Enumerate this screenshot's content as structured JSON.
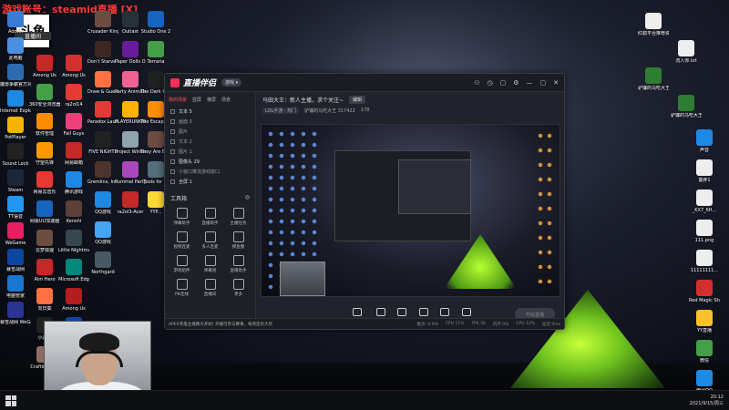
{
  "overlay": {
    "text": "游戏账号：steamid直播 [X]",
    "logo": "斗鱼",
    "logo_sub": "直播间",
    "room": "317422"
  },
  "desktop_left": [
    {
      "label": "Admin",
      "color": "#3a7bd5"
    },
    {
      "label": "此电脑",
      "color": "#4a90e2"
    },
    {
      "label": "魔兽争霸官方对战平台",
      "color": "#2b6cb0"
    },
    {
      "label": "Internet Explorer",
      "color": "#1e88e5"
    },
    {
      "label": "PotPlayer",
      "color": "#f4b400"
    },
    {
      "label": "Sound Lock",
      "color": "#222"
    },
    {
      "label": "Steam",
      "color": "#1b2838"
    },
    {
      "label": "TT语音",
      "color": "#2196f3"
    },
    {
      "label": "WeGame",
      "color": "#e91e63"
    },
    {
      "label": "暴雪战网",
      "color": "#0d47a1"
    },
    {
      "label": "电脑管家",
      "color": "#1976d2"
    },
    {
      "label": "暴雪战网 WeGame版",
      "color": "#283593"
    }
  ],
  "desktop_col2": [
    {
      "label": "Among Us",
      "color": "#c62828"
    },
    {
      "label": "360安全浏览器",
      "color": "#43a047"
    },
    {
      "label": "软件管理",
      "color": "#fb8c00"
    },
    {
      "label": "守望先锋",
      "color": "#ff9800"
    },
    {
      "label": "网易云音乐",
      "color": "#e53935"
    },
    {
      "label": "网易UU加速器",
      "color": "#1565c0"
    },
    {
      "label": "云梦狐狸",
      "color": "#6d4c41"
    },
    {
      "label": "Aim Hero",
      "color": "#c62828"
    },
    {
      "label": "向日葵",
      "color": "#ff7043"
    },
    {
      "label": "小黑盒",
      "color": "#212121"
    },
    {
      "label": "Crafting War",
      "color": "#8d6e63"
    }
  ],
  "desktop_col3": [
    {
      "label": "Among Us",
      "color": "#d32f2f"
    },
    {
      "label": "ra2ol14",
      "color": "#e53935"
    },
    {
      "label": "Fall Guys",
      "color": "#ec407a"
    },
    {
      "label": "网易邮箱",
      "color": "#c62828"
    },
    {
      "label": "腾讯游戏",
      "color": "#1e88e5"
    },
    {
      "label": "Kenshi",
      "color": "#5d4037"
    },
    {
      "label": "Little Nightmares",
      "color": "#37474f"
    },
    {
      "label": "Microsoft Edge",
      "color": "#00897b"
    },
    {
      "label": "Among Us",
      "color": "#b71c1c"
    },
    {
      "label": "英雄联盟",
      "color": "#0d47a1"
    }
  ],
  "desktop_col4": [
    {
      "label": "Crusader Kings III",
      "color": "#6d4c41"
    },
    {
      "label": "Don't Starve Together",
      "color": "#3e2723"
    },
    {
      "label": "Draw & Guess",
      "color": "#ff7043"
    },
    {
      "label": "Paradox Launcher v2",
      "color": "#e53935"
    },
    {
      "label": "FIVE NIGHTS",
      "color": "#212121"
    },
    {
      "label": "Gremlins, Inc.",
      "color": "#4e342e"
    },
    {
      "label": "QQ游戏",
      "color": "#1e88e5"
    },
    {
      "label": "QQ游戏",
      "color": "#42a5f5"
    },
    {
      "label": "Northgard",
      "color": "#455a64"
    }
  ],
  "desktop_col5": [
    {
      "label": "Outlast",
      "color": "#263238"
    },
    {
      "label": "Paper Dolls Original",
      "color": "#6a1b9a"
    },
    {
      "label": "Party Animals",
      "color": "#f06292"
    },
    {
      "label": "PLAYERUNKNOWN'S BATTLEGR",
      "color": "#ffb300"
    },
    {
      "label": "Project Winter",
      "color": "#90a4ae"
    },
    {
      "label": "Pummel Party",
      "color": "#ab47bc"
    },
    {
      "label": "ra2ol3-Acer",
      "color": "#c62828"
    }
  ],
  "desktop_col6": [
    {
      "label": "Studio One 2",
      "color": "#1565c0"
    },
    {
      "label": "Terraria",
      "color": "#43a047"
    },
    {
      "label": "The Dark Pictures",
      "color": "#212121"
    },
    {
      "label": "The Escapists",
      "color": "#ff8f00"
    },
    {
      "label": "They Are Billions",
      "color": "#6d4c41"
    },
    {
      "label": "Tools for ...",
      "color": "#546e7a"
    },
    {
      "label": "YYP...",
      "color": "#fdd835"
    }
  ],
  "desktop_right": [
    {
      "label": "红蜡平台推荐资讯.txt",
      "color": "#eeeeee"
    },
    {
      "label": "流入你.txt",
      "color": "#eeeeee"
    },
    {
      "label": "驴镰的马吃大王·萨克斯.xlsx",
      "color": "#2e7d32"
    },
    {
      "label": "驴镰的马吃大王·紧张.xlsx",
      "color": "#2e7d32"
    },
    {
      "label": "声音",
      "color": "#1e88e5"
    },
    {
      "label": "童胖1",
      "color": "#eeeeee"
    },
    {
      "label": "_KX7_6H...",
      "color": "#eeeeee"
    },
    {
      "label": "111.png",
      "color": "#eeeeee"
    },
    {
      "label": "11111111...",
      "color": "#eeeeee"
    },
    {
      "label": "Red Magic Studio",
      "color": "#d32f2f"
    },
    {
      "label": "YY直播",
      "color": "#fbc02d"
    },
    {
      "label": "微信",
      "color": "#43a047"
    },
    {
      "label": "腾讯QQ",
      "color": "#1e88e5"
    }
  ],
  "app": {
    "brand": "直播伴侣",
    "badge": "游戏 ▾",
    "title_icons": [
      "⚇",
      "◷",
      "▢",
      "⚙",
      "—",
      "▢",
      "✕"
    ],
    "side_tabs": [
      "我的场景",
      "竖屏",
      "横屏",
      "场景"
    ],
    "scenes": [
      "文本 5",
      "画面 3",
      "图片",
      "文本 2",
      "图片 1",
      "图像头 29",
      "小窗口推流游戏窗口",
      "全屏 1"
    ],
    "tools_title": "工具箱",
    "tools": [
      "弹幕助手",
      "直播助手",
      "主播任务",
      "视频连麦",
      "多人连麦",
      "摸鱼圈",
      "游戏组件",
      "弹幕组",
      "直播助手",
      "PK连线",
      "直播间",
      "更多"
    ],
    "stream_title": "马田大王：新人主播，求个关注~",
    "edit_label": "编辑",
    "room_tag": "LOL手游 · 热门",
    "room_info": "驴镰的马吃大王 317422",
    "viewers": "178",
    "controls": [
      "直播屏幕",
      "摄像头",
      "多机位",
      "多画面",
      "麦克风",
      "扬声器"
    ],
    "go_live": "开始直播",
    "notice": "APEX英雄主播赛大开始! 开播可参与赛事，每周还有大奖",
    "status": [
      "推流: 0.0%",
      "CPU 11%",
      "FPS 30",
      "内存 0%",
      "CPU 12%",
      "延迟 0ms"
    ]
  },
  "taskbar": {
    "time": "20:12",
    "date": "2021/9/15/周三"
  }
}
